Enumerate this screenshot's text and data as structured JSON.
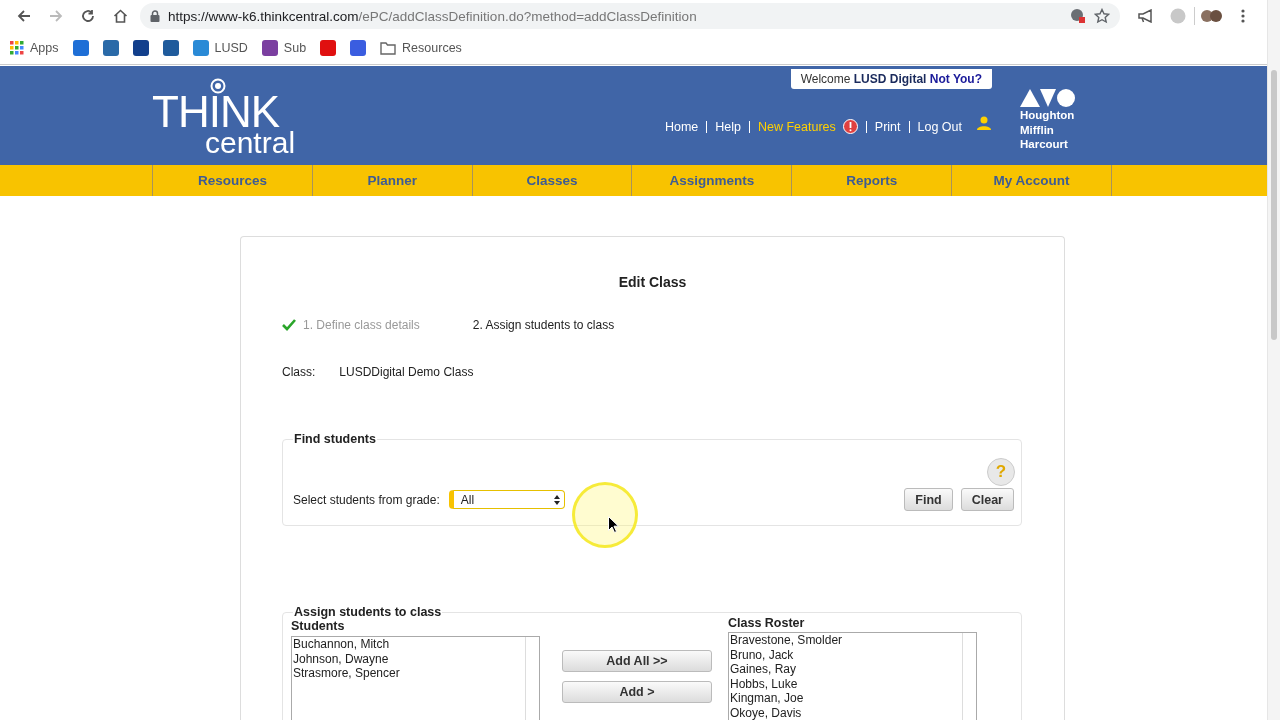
{
  "browser": {
    "url_host": "https://www-k6.thinkcentral.com",
    "url_path": "/ePC/addClassDefinition.do?method=addClassDefinition",
    "bookmarks": [
      {
        "kind": "apps",
        "label": "Apps"
      },
      {
        "kind": "icon",
        "color": "#1e6fd6"
      },
      {
        "kind": "icon",
        "color": "#2a6aa8"
      },
      {
        "kind": "icon",
        "color": "#123f8c"
      },
      {
        "kind": "icon",
        "color": "#1f5b9c"
      },
      {
        "kind": "labeled",
        "label": "LUSD",
        "color": "#2a8ad6"
      },
      {
        "kind": "labeled",
        "label": "Sub",
        "color": "#7b3fa0"
      },
      {
        "kind": "icon",
        "color": "#e01010"
      },
      {
        "kind": "icon",
        "color": "#3a5de0"
      },
      {
        "kind": "folder",
        "label": "Resources"
      }
    ]
  },
  "header": {
    "logo_top": "THINK",
    "logo_bottom": "central",
    "welcome": "Welcome",
    "user": "LUSD Digital",
    "not_you": "Not You?",
    "links": [
      {
        "label": "Home",
        "highlight": false
      },
      {
        "label": "Help",
        "highlight": false
      },
      {
        "label": "New Features",
        "highlight": true
      },
      {
        "label": "Print",
        "highlight": false
      },
      {
        "label": "Log Out",
        "highlight": false
      }
    ],
    "publisher": [
      "Houghton",
      "Mifflin",
      "Harcourt"
    ]
  },
  "nav": [
    {
      "label": "Resources",
      "selected": false
    },
    {
      "label": "Planner",
      "selected": false
    },
    {
      "label": "Classes",
      "selected": false
    },
    {
      "label": "Assignments",
      "selected": false
    },
    {
      "label": "Reports",
      "selected": false
    },
    {
      "label": "My Account",
      "selected": false
    }
  ],
  "card": {
    "title": "Edit Class",
    "steps": [
      {
        "label": "1. Define class details",
        "done": true
      },
      {
        "label": "2. Assign students to class",
        "done": false
      }
    ],
    "class_label": "Class:",
    "class_name": "LUSDDigital Demo Class",
    "find": {
      "legend": "Find students",
      "help": "?",
      "grade_label": "Select students from grade:",
      "grade_value": "All",
      "buttons": [
        "Find",
        "Clear"
      ]
    },
    "assign": {
      "legend": "Assign students to class",
      "students_label": "Students",
      "students": [
        "Buchannon, Mitch",
        "Johnson, Dwayne",
        "Strasmore, Spencer"
      ],
      "buttons": [
        "Add All >>",
        "Add >"
      ],
      "roster_label": "Class Roster",
      "roster": [
        "Bravestone, Smolder",
        "Bruno, Jack",
        "Gaines, Ray",
        "Hobbs, Luke",
        "Kingman, Joe",
        "Okoye, Davis"
      ]
    }
  }
}
